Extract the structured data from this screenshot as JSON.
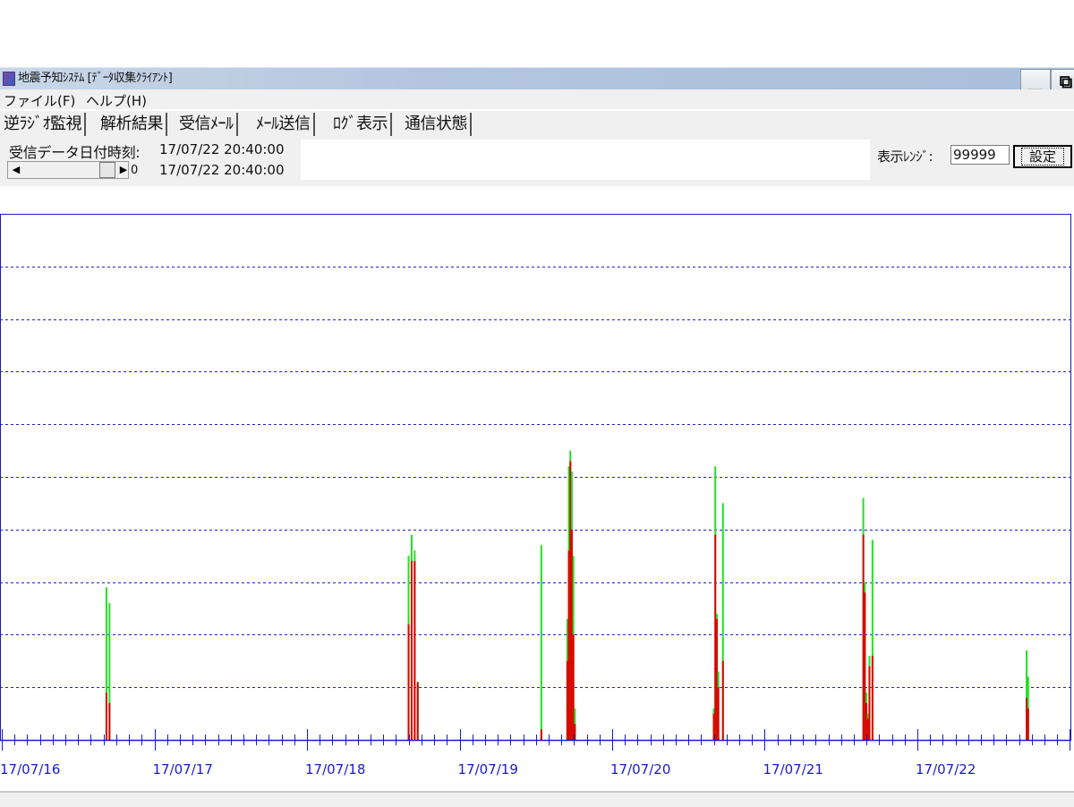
{
  "window": {
    "title": "地震予知ｼｽﾃﾑ [ﾃﾞｰﾀ収集ｸﾗｲｱﾝﾄ]",
    "minimize_glyph": "▁",
    "restore_glyph": "⧉"
  },
  "menu": [
    "ファイル(F)",
    "ヘルプ(H)"
  ],
  "tabs": [
    {
      "label": "逆ﾗｼﾞｵ監視",
      "active": true
    },
    {
      "label": "解析結果",
      "active": false
    },
    {
      "label": "受信ﾒｰﾙ",
      "active": false
    },
    {
      "label": "ﾒｰﾙ送信",
      "active": false
    },
    {
      "label": "ﾛｸﾞ表示",
      "active": false
    },
    {
      "label": "通信状態",
      "active": false
    }
  ],
  "info": {
    "received_label": "受信データ日付時刻:",
    "received_datetime": "17/07/22 20:40:00",
    "current_datetime": "17/07/22 20:40:00",
    "scroll_value": "0",
    "scroll_left_glyph": "◀",
    "scroll_right_glyph": "▶"
  },
  "range": {
    "label": "表示ﾚﾝｼﾞ:",
    "value": "99999",
    "button_label": "設定"
  },
  "chart_data": {
    "type": "bar",
    "x_labels": [
      "17/07/16",
      "17/07/17",
      "17/07/18",
      "17/07/19",
      "17/07/20",
      "17/07/21",
      "17/07/22"
    ],
    "ylim": [
      0,
      10
    ],
    "grid": "horizontal dashed",
    "legend": "none",
    "colors": {
      "green": "#22e022",
      "red": "#e00000",
      "axis": "#1a1acc",
      "grid": "#2020d0"
    },
    "spikes": [
      {
        "day": 0.68,
        "green": 2.9,
        "red": 0.9
      },
      {
        "day": 0.7,
        "green": 2.6,
        "red": 0.7
      },
      {
        "day": 2.66,
        "green": 3.5,
        "red": 2.2
      },
      {
        "day": 2.68,
        "green": 3.9,
        "red": 3.4
      },
      {
        "day": 2.7,
        "green": 3.6,
        "red": 3.4
      },
      {
        "day": 2.72,
        "green": 1.1,
        "red": 1.1
      },
      {
        "day": 3.53,
        "green": 3.7,
        "red": 0.2
      },
      {
        "day": 3.7,
        "green": 2.3,
        "red": 1.5
      },
      {
        "day": 3.71,
        "green": 5.2,
        "red": 3.6
      },
      {
        "day": 3.72,
        "green": 5.5,
        "red": 5.3
      },
      {
        "day": 3.73,
        "green": 5.1,
        "red": 4.0
      },
      {
        "day": 3.74,
        "green": 3.5,
        "red": 2.0
      },
      {
        "day": 3.75,
        "green": 0.6,
        "red": 0.3
      },
      {
        "day": 4.66,
        "green": 0.6,
        "red": 0.5
      },
      {
        "day": 4.67,
        "green": 5.2,
        "red": 3.9
      },
      {
        "day": 4.68,
        "green": 2.4,
        "red": 2.3
      },
      {
        "day": 4.69,
        "green": 1.3,
        "red": 1.0
      },
      {
        "day": 4.72,
        "green": 4.5,
        "red": 1.5
      },
      {
        "day": 5.64,
        "green": 4.6,
        "red": 3.9
      },
      {
        "day": 5.65,
        "green": 3.0,
        "red": 2.8
      },
      {
        "day": 5.66,
        "green": 0.9,
        "red": 0.7
      },
      {
        "day": 5.67,
        "green": 0.5,
        "red": 0.4
      },
      {
        "day": 5.68,
        "green": 1.6,
        "red": 1.4
      },
      {
        "day": 5.7,
        "green": 3.8,
        "red": 1.6
      },
      {
        "day": 6.71,
        "green": 1.7,
        "red": 0.8
      },
      {
        "day": 6.72,
        "green": 1.2,
        "red": 0.6
      }
    ]
  }
}
